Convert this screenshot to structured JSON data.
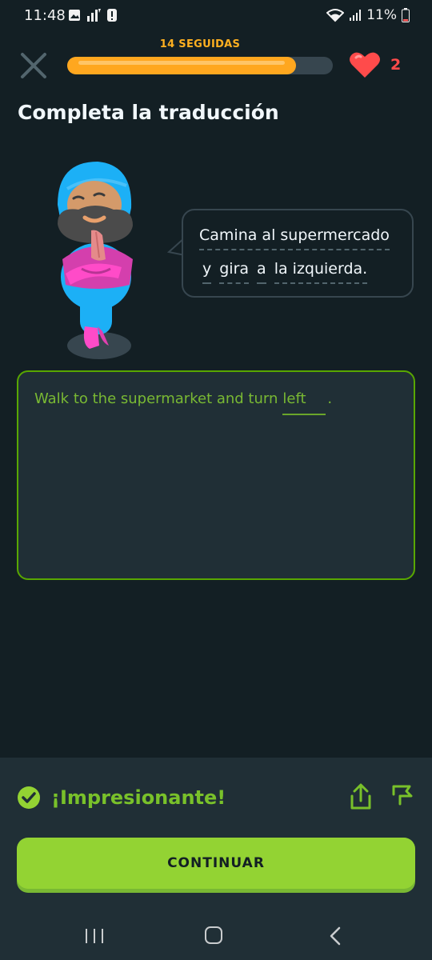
{
  "status_bar": {
    "time": "11:48",
    "battery": "11%"
  },
  "header": {
    "streak_label": "14 SEGUIDAS",
    "progress": 0.86,
    "hearts": "2",
    "accent": "#ffa71f"
  },
  "lesson": {
    "title": "Completa la traducción",
    "prompt_line1": "Camina al supermercado",
    "prompt_words_line2": [
      "y",
      "gira",
      "a",
      "la izquierda."
    ],
    "answer_text": "Walk to the supermarket and turn",
    "answer_fill": "left",
    "answer_period": "."
  },
  "feedback": {
    "message": "¡Impresionante!",
    "continue_label": "CONTINUAR",
    "success_color": "#93d333"
  },
  "icons": {
    "close": "close-icon",
    "heart": "heart-icon",
    "check": "check-circle-icon",
    "share": "share-icon",
    "flag": "flag-icon"
  }
}
